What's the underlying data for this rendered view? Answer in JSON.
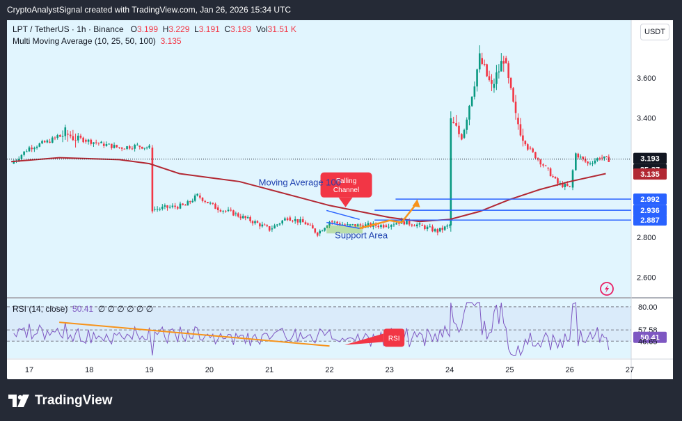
{
  "topbar": {
    "text": "CryptoAnalystSignal created with TradingView.com, Jan 26, 2026 15:34 UTC"
  },
  "symbol_line": {
    "symbol": "LPT / TetherUS · 1h · Binance",
    "open_label": "O",
    "open": "3.199",
    "high_label": "H",
    "high": "3.229",
    "low_label": "L",
    "low": "3.191",
    "close_label": "C",
    "close": "3.193",
    "vol_label": "Vol",
    "vol": "31.51 K"
  },
  "ma_line": {
    "label": "Multi Moving Average (10, 25, 50, 100)",
    "value": "3.135"
  },
  "currency": "USDT",
  "rsi_header": {
    "label": "RSI (14, close)",
    "value": "50.41",
    "extras": "∅ ∅ ∅ ∅ ∅ ∅"
  },
  "brand": "TradingView",
  "colors": {
    "up": "#089981",
    "down": "#f23645",
    "ma": "#b22833",
    "level": "#2962ff",
    "rsi": "#7e57c2",
    "trend": "#f7931a",
    "bg": "#e1f5fe"
  },
  "annotations": {
    "moving_average": "Moving Average 100",
    "channel_line1": "Falling",
    "channel_line2": "Channel",
    "support": "Support Area",
    "rsi_callout": "RSI"
  },
  "chart_data": {
    "type": "candlestick",
    "x_ticks": [
      "17",
      "18",
      "19",
      "20",
      "21",
      "22",
      "23",
      "24",
      "25",
      "26",
      "27"
    ],
    "y_ticks": [
      2.6,
      2.8,
      3.4,
      3.6
    ],
    "ylim": [
      2.5,
      3.89
    ],
    "price_labels": [
      {
        "value": "3.193",
        "kind": "last"
      },
      {
        "value": "25:37",
        "kind": "timer"
      },
      {
        "value": "3.135",
        "kind": "ma"
      },
      {
        "value": "2.992",
        "kind": "level"
      },
      {
        "value": "2.936",
        "kind": "level"
      },
      {
        "value": "2.887",
        "kind": "level"
      }
    ],
    "levels": [
      2.992,
      2.936,
      2.887
    ],
    "last_price": 3.193,
    "ma_value": 3.135,
    "ma100": [
      [
        16.7,
        3.18
      ],
      [
        17.5,
        3.2
      ],
      [
        18.5,
        3.19
      ],
      [
        19.0,
        3.17
      ],
      [
        19.5,
        3.12
      ],
      [
        20.0,
        3.1
      ],
      [
        20.5,
        3.08
      ],
      [
        21.0,
        3.04
      ],
      [
        21.5,
        3.0
      ],
      [
        22.0,
        2.96
      ],
      [
        22.5,
        2.93
      ],
      [
        23.0,
        2.9
      ],
      [
        23.5,
        2.88
      ],
      [
        24.0,
        2.89
      ],
      [
        24.5,
        2.93
      ],
      [
        25.0,
        2.99
      ],
      [
        25.5,
        3.04
      ],
      [
        26.0,
        3.08
      ],
      [
        26.6,
        3.12
      ]
    ],
    "ohlc_path": [
      [
        16.7,
        3.17
      ],
      [
        17.0,
        3.25
      ],
      [
        17.3,
        3.28
      ],
      [
        17.6,
        3.32
      ],
      [
        17.9,
        3.29
      ],
      [
        18.2,
        3.27
      ],
      [
        18.5,
        3.25
      ],
      [
        18.8,
        3.26
      ],
      [
        19.0,
        3.25
      ],
      [
        19.05,
        2.94
      ],
      [
        19.3,
        2.95
      ],
      [
        19.6,
        2.96
      ],
      [
        19.8,
        3.01
      ],
      [
        20.1,
        2.95
      ],
      [
        20.4,
        2.92
      ],
      [
        20.8,
        2.87
      ],
      [
        21.0,
        2.84
      ],
      [
        21.3,
        2.9
      ],
      [
        21.6,
        2.87
      ],
      [
        21.8,
        2.82
      ],
      [
        22.0,
        2.88
      ],
      [
        22.3,
        2.86
      ],
      [
        22.6,
        2.86
      ],
      [
        22.9,
        2.86
      ],
      [
        23.2,
        2.88
      ],
      [
        23.5,
        2.86
      ],
      [
        23.8,
        2.83
      ],
      [
        24.0,
        2.86
      ],
      [
        24.02,
        3.38
      ],
      [
        24.2,
        3.3
      ],
      [
        24.5,
        3.7
      ],
      [
        24.7,
        3.55
      ],
      [
        24.9,
        3.7
      ],
      [
        25.1,
        3.4
      ],
      [
        25.3,
        3.25
      ],
      [
        25.6,
        3.15
      ],
      [
        25.8,
        3.07
      ],
      [
        26.0,
        3.05
      ],
      [
        26.1,
        3.22
      ],
      [
        26.3,
        3.17
      ],
      [
        26.5,
        3.2
      ],
      [
        26.65,
        3.19
      ]
    ],
    "rsi": {
      "value": 50.41,
      "levels": [
        80.0,
        57.58,
        46.65
      ],
      "ylim": [
        30,
        88
      ],
      "tick_labels": [
        "80.00",
        "57.58",
        "50.41",
        "46.65"
      ]
    }
  }
}
